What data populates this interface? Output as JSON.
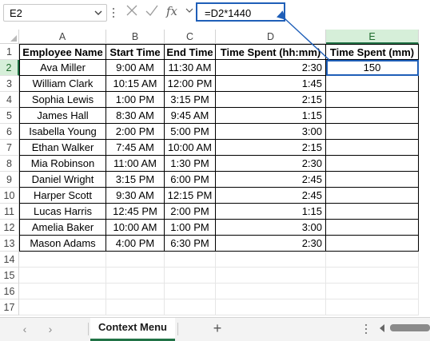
{
  "formula_bar": {
    "name_box": "E2",
    "formula": "=D2*1440",
    "fx_label": "fx"
  },
  "columns": [
    "A",
    "B",
    "C",
    "D",
    "E"
  ],
  "rows": [
    "1",
    "2",
    "3",
    "4",
    "5",
    "6",
    "7",
    "8",
    "9",
    "10",
    "11",
    "12",
    "13",
    "14",
    "15",
    "16",
    "17"
  ],
  "table": {
    "headers": [
      "Employee Name",
      "Start Time",
      "End Time",
      "Time Spent (hh:mm)",
      "Time Spent (mm)"
    ],
    "data": [
      [
        "Ava Miller",
        "9:00 AM",
        "11:30 AM",
        "2:30",
        "150"
      ],
      [
        "William Clark",
        "10:15 AM",
        "12:00 PM",
        "1:45",
        ""
      ],
      [
        "Sophia Lewis",
        "1:00 PM",
        "3:15 PM",
        "2:15",
        ""
      ],
      [
        "James Hall",
        "8:30 AM",
        "9:45 AM",
        "1:15",
        ""
      ],
      [
        "Isabella Young",
        "2:00 PM",
        "5:00 PM",
        "3:00",
        ""
      ],
      [
        "Ethan Walker",
        "7:45 AM",
        "10:00 AM",
        "2:15",
        ""
      ],
      [
        "Mia Robinson",
        "11:00 AM",
        "1:30 PM",
        "2:30",
        ""
      ],
      [
        "Daniel Wright",
        "3:15 PM",
        "6:00 PM",
        "2:45",
        ""
      ],
      [
        "Harper Scott",
        "9:30 AM",
        "12:15 PM",
        "2:45",
        ""
      ],
      [
        "Lucas Harris",
        "12:45 PM",
        "2:00 PM",
        "1:15",
        ""
      ],
      [
        "Amelia Baker",
        "10:00 AM",
        "1:00 PM",
        "3:00",
        ""
      ],
      [
        "Mason Adams",
        "4:00 PM",
        "6:30 PM",
        "2:30",
        ""
      ]
    ]
  },
  "sheet_tabs": {
    "active": "Context Menu",
    "add": "+"
  },
  "icons": {
    "name_box_dropdown": "chevron-down-icon",
    "cancel": "close-icon",
    "enter": "checkmark-icon",
    "insert_function": "fx-icon",
    "prev_sheet": "chevron-left-icon",
    "next_sheet": "chevron-right-icon"
  },
  "colors": {
    "selection_blue": "#1f5fb8",
    "header_selected_bg": "#d6efd9",
    "excel_green": "#217346"
  }
}
